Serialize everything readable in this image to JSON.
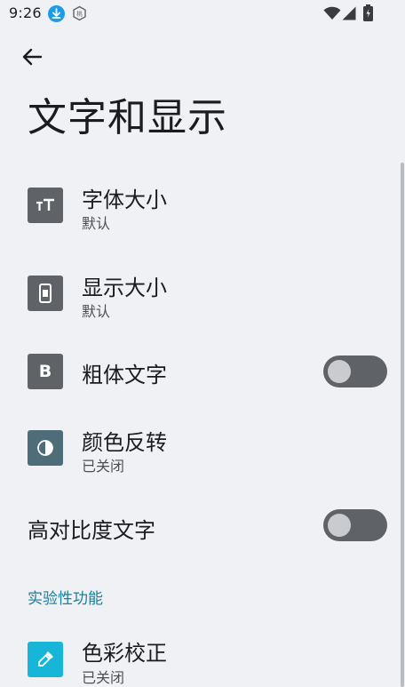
{
  "status_bar": {
    "time": "9:26",
    "hex_icon_text": "桃"
  },
  "header": {
    "back_icon": "arrow-back-icon",
    "title": "文字和显示"
  },
  "settings": {
    "font_size": {
      "title": "字体大小",
      "subtitle": "默认",
      "icon": "font-size-icon"
    },
    "display_size": {
      "title": "显示大小",
      "subtitle": "默认",
      "icon": "display-size-icon"
    },
    "bold_text": {
      "title": "粗体文字",
      "icon_label": "B",
      "toggle_on": false
    },
    "color_inversion": {
      "title": "颜色反转",
      "subtitle": "已关闭",
      "icon": "color-inversion-icon"
    },
    "high_contrast_text": {
      "title": "高对比度文字",
      "toggle_on": false
    }
  },
  "experimental": {
    "header": "实验性功能",
    "color_correction": {
      "title": "色彩校正",
      "subtitle": "已关闭",
      "icon": "eyedropper-icon"
    }
  },
  "colors": {
    "background": "#eff1f5",
    "icon_gray": "#5f6368",
    "accent_teal": "#1a7f9a",
    "accent_cyan": "#17b5d8",
    "download_blue": "#1e9be8"
  }
}
